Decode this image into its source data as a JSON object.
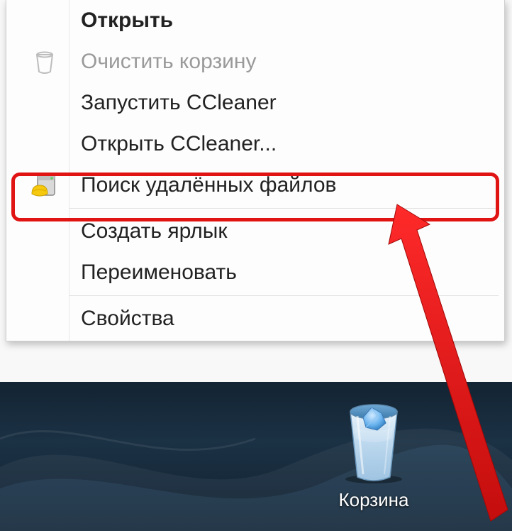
{
  "desktop": {
    "recycle_bin_label": "Корзина"
  },
  "menu": {
    "items": [
      {
        "label": "Открыть",
        "bold": true,
        "disabled": false,
        "icon": null
      },
      {
        "label": "Очистить корзину",
        "bold": false,
        "disabled": true,
        "icon": "recycle-bin-icon"
      },
      {
        "label": "Запустить CCleaner",
        "bold": false,
        "disabled": false,
        "icon": null
      },
      {
        "label": "Открыть CCleaner...",
        "bold": false,
        "disabled": false,
        "icon": null
      },
      {
        "label": "Поиск удалённых файлов",
        "bold": false,
        "disabled": false,
        "icon": "recuva-icon",
        "highlighted": true
      },
      {
        "label": "Создать ярлык",
        "bold": false,
        "disabled": false,
        "icon": null
      },
      {
        "label": "Переименовать",
        "bold": false,
        "disabled": false,
        "icon": null
      },
      {
        "label": "Свойства",
        "bold": false,
        "disabled": false,
        "icon": null
      }
    ],
    "separators_after_index": [
      4,
      6
    ]
  },
  "annotation": {
    "highlight_color": "#e11414"
  }
}
